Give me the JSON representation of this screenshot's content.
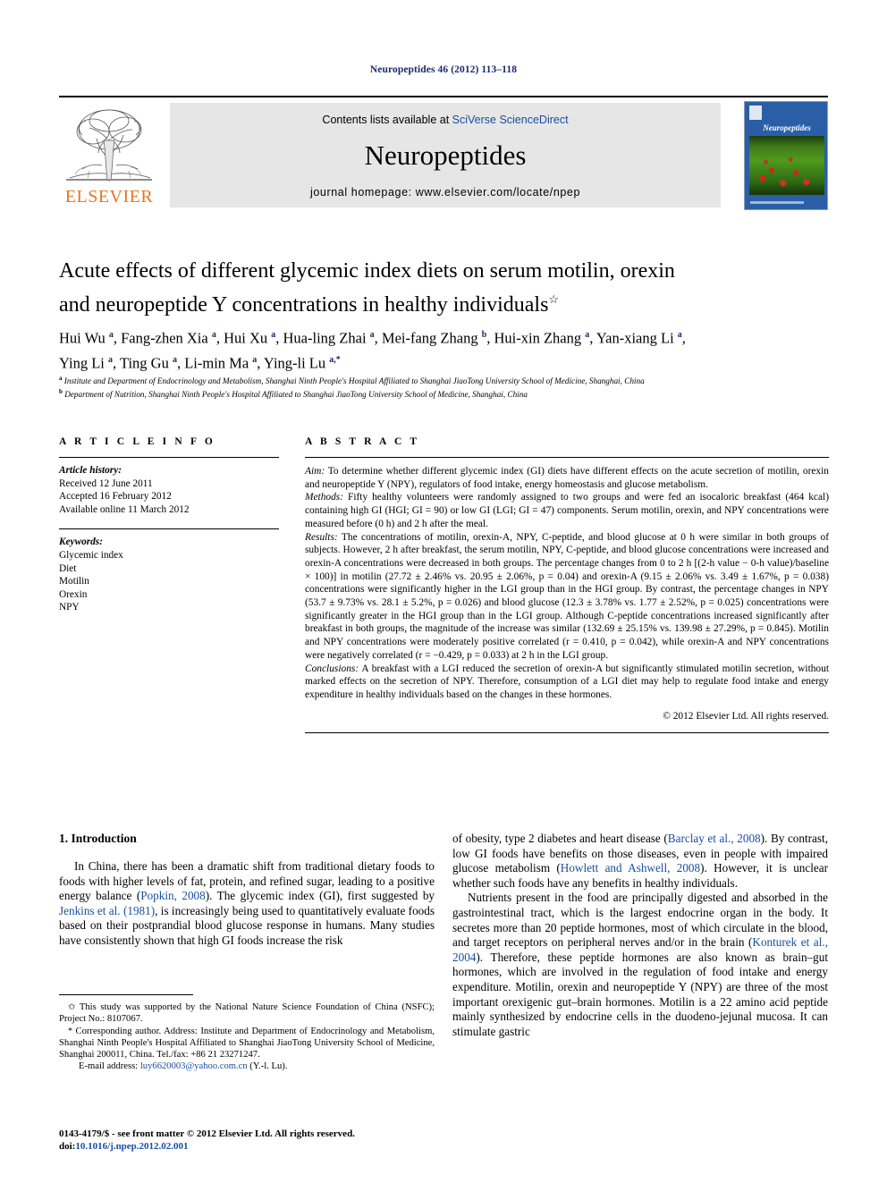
{
  "running_head": "Neuropeptides 46 (2012) 113–118",
  "masthead": {
    "contents_prefix": "Contents lists available at ",
    "contents_link": "SciVerse ScienceDirect",
    "journal_name": "Neuropeptides",
    "homepage": "journal homepage: www.elsevier.com/locate/npep",
    "publisher_wordmark": "ELSEVIER",
    "cover_title": "Neuropeptides"
  },
  "article": {
    "title_line1": "Acute effects of different glycemic index diets on serum motilin, orexin",
    "title_line2": "and neuropeptide Y concentrations in healthy individuals",
    "title_footnote_mark": "☆",
    "authors": "Hui Wu a, Fang-zhen Xia a, Hui Xu a, Hua-ling Zhai a, Mei-fang Zhang b, Hui-xin Zhang a, Yan-xiang Li a, Ying Li a, Ting Gu a, Li-min Ma a, Ying-li Lu a,*",
    "affiliation_a": "Institute and Department of Endocrinology and Metabolism, Shanghai Ninth People's Hospital Affiliated to Shanghai JiaoTong University School of Medicine, Shanghai, China",
    "affiliation_b": "Department of Nutrition, Shanghai Ninth People's Hospital Affiliated to Shanghai JiaoTong University School of Medicine, Shanghai, China"
  },
  "article_info": {
    "heading": "A R T I C L E  I N F O",
    "history_label": "Article history:",
    "received": "Received 12 June 2011",
    "accepted": "Accepted 16 February 2012",
    "available": "Available online 11 March 2012",
    "keywords_label": "Keywords:",
    "keywords": [
      "Glycemic index",
      "Diet",
      "Motilin",
      "Orexin",
      "NPY"
    ]
  },
  "abstract": {
    "heading": "A B S T R A C T",
    "aim_label": "Aim:",
    "aim_text": " To determine whether different glycemic index (GI) diets have different effects on the acute secretion of motilin, orexin and neuropeptide Y (NPY), regulators of food intake, energy homeostasis and glucose metabolism.",
    "methods_label": "Methods:",
    "methods_text": " Fifty healthy volunteers were randomly assigned to two groups and were fed an isocaloric breakfast (464 kcal) containing high GI (HGI; GI = 90) or low GI (LGI; GI = 47) components. Serum motilin, orexin, and NPY concentrations were measured before (0 h) and 2 h after the meal.",
    "results_label": "Results:",
    "results_text": " The concentrations of motilin, orexin-A, NPY, C-peptide, and blood glucose at 0 h were similar in both groups of subjects. However, 2 h after breakfast, the serum motilin, NPY, C-peptide, and blood glucose concentrations were increased and orexin-A concentrations were decreased in both groups. The percentage changes from 0 to 2 h [(2-h value − 0-h value)/baseline × 100)] in motilin (27.72 ± 2.46% vs. 20.95 ± 2.06%, p = 0.04) and orexin-A (9.15 ± 2.06% vs. 3.49 ± 1.67%, p = 0.038) concentrations were significantly higher in the LGI group than in the HGI group. By contrast, the percentage changes in NPY (53.7 ± 9.73% vs. 28.1 ± 5.2%, p = 0.026) and blood glucose (12.3 ± 3.78% vs. 1.77 ± 2.52%, p = 0.025) concentrations were significantly greater in the HGI group than in the LGI group. Although C-peptide concentrations increased significantly after breakfast in both groups, the magnitude of the increase was similar (132.69 ± 25.15% vs. 139.98 ± 27.29%, p = 0.845). Motilin and NPY concentrations were moderately positive correlated (r = 0.410, p = 0.042), while orexin-A and NPY concentrations were negatively correlated (r = −0.429, p = 0.033) at 2 h in the LGI group.",
    "conclusions_label": "Conclusions:",
    "conclusions_text": " A breakfast with a LGI reduced the secretion of orexin-A but significantly stimulated motilin secretion, without marked effects on the secretion of NPY. Therefore, consumption of a LGI diet may help to regulate food intake and energy expenditure in healthy individuals based on the changes in these hormones.",
    "copyright": "© 2012 Elsevier Ltd. All rights reserved."
  },
  "introduction": {
    "heading": "1. Introduction",
    "para1_a": "In China, there has been a dramatic shift from traditional dietary foods to foods with higher levels of fat, protein, and refined sugar, leading to a positive energy balance (",
    "para1_ref1": "Popkin, 2008",
    "para1_b": "). The glycemic index (GI), first suggested by ",
    "para1_ref2": "Jenkins et al. (1981)",
    "para1_c": ", is increasingly being used to quantitatively evaluate foods based on their postprandial blood glucose response in humans. Many studies have consistently shown that high GI foods increase the risk",
    "para2_a": "of obesity, type 2 diabetes and heart disease (",
    "para2_ref1": "Barclay et al., 2008",
    "para2_b": "). By contrast, low GI foods have benefits on those diseases, even in people with impaired glucose metabolism (",
    "para2_ref2": "Howlett and Ashwell, 2008",
    "para2_c": "). However, it is unclear whether such foods have any benefits in healthy individuals.",
    "para3_a": "Nutrients present in the food are principally digested and absorbed in the gastrointestinal tract, which is the largest endocrine organ in the body. It secretes more than 20 peptide hormones, most of which circulate in the blood, and target receptors on peripheral nerves and/or in the brain (",
    "para3_ref1": "Konturek et al., 2004",
    "para3_b": "). Therefore, these peptide hormones are also known as brain–gut hormones, which are involved in the regulation of food intake and energy expenditure. Motilin, orexin and neuropeptide Y (NPY) are three of the most important orexigenic gut–brain hormones. Motilin is a 22 amino acid peptide mainly synthesized by endocrine cells in the duodeno-jejunal mucosa. It can stimulate gastric"
  },
  "footnotes": {
    "star_mark": "✩",
    "star_text": " This study was supported by the National Nature Science Foundation of China (NSFC); Project No.: 8107067.",
    "corr_mark": "*",
    "corr_text": " Corresponding author. Address: Institute and Department of Endocrinology and Metabolism, Shanghai Ninth People's Hospital Affiliated to Shanghai JiaoTong University School of Medicine, Shanghai 200011, China. Tel./fax: +86 21 23271247.",
    "email_label": "E-mail address:",
    "email_value": "luy6620003@yahoo.com.cn",
    "email_suffix": " (Y.-l. Lu)."
  },
  "footer": {
    "issn_line": "0143-4179/$ - see front matter © 2012 Elsevier Ltd. All rights reserved.",
    "doi_label": "doi:",
    "doi_value": "10.1016/j.npep.2012.02.001"
  },
  "colors": {
    "link_blue": "#1a4fa0",
    "header_navy": "#1b2a6b",
    "elsevier_orange": "#e87722",
    "masthead_gray": "#e6e6e6"
  }
}
